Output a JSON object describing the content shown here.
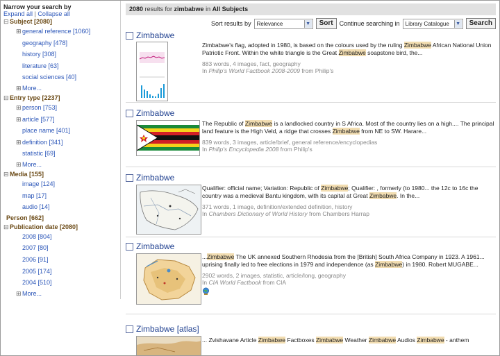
{
  "sidebar": {
    "title": "Narrow your search by",
    "expand_all": "Expand all",
    "separator": "|",
    "collapse_all": "Collapse all",
    "subject": {
      "label": "Subject [2080]",
      "items": [
        {
          "label": "general reference [1060]",
          "toggle": "⊞"
        },
        {
          "label": "geography [478]",
          "toggle": ""
        },
        {
          "label": "history [308]",
          "toggle": ""
        },
        {
          "label": "literature [63]",
          "toggle": ""
        },
        {
          "label": "social sciences [40]",
          "toggle": ""
        }
      ],
      "more": "More..."
    },
    "entry_type": {
      "label": "Entry type [2237]",
      "items": [
        {
          "label": "person [753]",
          "toggle": "⊞"
        },
        {
          "label": "article [577]",
          "toggle": "⊞"
        },
        {
          "label": "place name [401]",
          "toggle": ""
        },
        {
          "label": "definition [341]",
          "toggle": "⊞"
        },
        {
          "label": "statistic [69]",
          "toggle": ""
        }
      ],
      "more": "More..."
    },
    "media": {
      "label": "Media [155]",
      "items": [
        "image [124]",
        "map [17]",
        "audio [14]"
      ]
    },
    "person": "Person [662]",
    "publication_date": {
      "label": "Publication date [2080]",
      "items": [
        "2008 [804]",
        "2007 [80]",
        "2006 [91]",
        "2005 [174]",
        "2004 [510]"
      ],
      "more": "More..."
    }
  },
  "results_bar": {
    "count": "2080",
    "text1": " results for ",
    "query": "zimbabwe",
    "text2": " in ",
    "scope": "All Subjects"
  },
  "sort": {
    "label": "Sort results by",
    "value": "Relevance",
    "sort_button": "Sort",
    "continue_label": "Continue searching in",
    "catalogue_value": "Library Catalogue",
    "search_button": "Search"
  },
  "results": [
    {
      "title": "Zimbabwe",
      "snippet": [
        {
          "t": "Zimbabwe's flag, adopted in 1980, is based on the colours used by the ruling ",
          "h": false
        },
        {
          "t": "Zimbabwe",
          "h": true
        },
        {
          "t": " African National Union Patriotic Front. Within the white triangle is the Great ",
          "h": false
        },
        {
          "t": "Zimbabwe",
          "h": true
        },
        {
          "t": " soapstone bird, the...",
          "h": false
        }
      ],
      "meta": "883 words, 4 images, fact, geography",
      "src_pre": "In ",
      "src_title": "Philip's World Factbook 2008-2009",
      "src_post": " from Philip's"
    },
    {
      "title": "Zimbabwe",
      "snippet": [
        {
          "t": "The Republic of ",
          "h": false
        },
        {
          "t": "Zimbabwe",
          "h": true
        },
        {
          "t": " is a landlocked country in S Africa. Most of the country lies on a high.... The principal land feature is the High Veld, a ridge that crosses ",
          "h": false
        },
        {
          "t": "Zimbabwe",
          "h": true
        },
        {
          "t": " from NE to SW. Harare...",
          "h": false
        }
      ],
      "meta": "839 words, 3 images, article/brief, general reference/encyclopedias",
      "src_pre": "In ",
      "src_title": "Philip's Encyclopedia 2008",
      "src_post": " from Philip's"
    },
    {
      "title": "Zimbabwe",
      "snippet": [
        {
          "t": "Qualifier: official name; Variation: Republic of ",
          "h": false
        },
        {
          "t": "Zimbabwe",
          "h": true
        },
        {
          "t": "; Qualifier: , formerly (to 1980... the 12c to 16c the country was a medieval Bantu kingdom, with its capital at Great ",
          "h": false
        },
        {
          "t": "Zimbabwe",
          "h": true
        },
        {
          "t": ". In the...",
          "h": false
        }
      ],
      "meta": "371 words, 1 image, definition/extended definition, history",
      "src_pre": "In ",
      "src_title": "Chambers Dictionary of World History",
      "src_post": " from Chambers Harrap"
    },
    {
      "title": "Zimbabwe",
      "snippet": [
        {
          "t": "...",
          "h": false
        },
        {
          "t": "Zimbabwe",
          "h": true
        },
        {
          "t": " The UK annexed Southern Rhodesia from the [British] South Africa Company in 1923. A 1961... uprising finally led to free elections in 1979 and independence (as ",
          "h": false
        },
        {
          "t": "Zimbabwe",
          "h": true
        },
        {
          "t": ") in 1980. Robert MUGABE...",
          "h": false
        }
      ],
      "meta": "2902 words, 2 images, statistic, article/long, geography",
      "src_pre": "In ",
      "src_title": "CIA World Factbook",
      "src_post": " from CIA"
    },
    {
      "title": "Zimbabwe [atlas]",
      "snippet": [
        {
          "t": "... Zvishavane Article ",
          "h": false
        },
        {
          "t": "Zimbabwe",
          "h": true
        },
        {
          "t": " Factboxes ",
          "h": false
        },
        {
          "t": "Zimbabwe",
          "h": true
        },
        {
          "t": " Weather ",
          "h": false
        },
        {
          "t": "Zimbabwe",
          "h": true
        },
        {
          "t": " Audios ",
          "h": false
        },
        {
          "t": "Zimbabwe",
          "h": true
        },
        {
          "t": " - anthem",
          "h": false
        }
      ],
      "meta": "",
      "src_pre": "",
      "src_title": "",
      "src_post": ""
    }
  ]
}
